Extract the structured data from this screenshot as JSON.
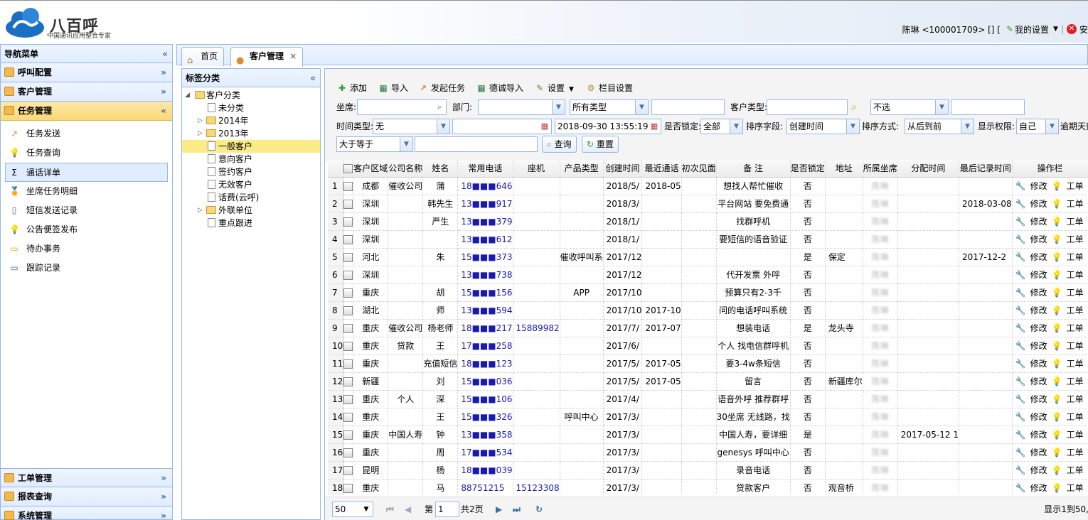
{
  "header": {
    "logo_text": "八百呼",
    "logo_subtitle": "中国通讯应用整合专家",
    "user": "陈琳 <100001709> [] [",
    "my_settings": "我的设置",
    "logout_fragment": "安"
  },
  "nav": {
    "title": "导航菜单",
    "collapse": "«",
    "sections_top": [
      {
        "label": "呼叫配置",
        "chev": "»"
      },
      {
        "label": "客户管理",
        "chev": "»"
      }
    ],
    "active_section": {
      "label": "任务管理",
      "chev": "«"
    },
    "items": [
      {
        "label": "任务发送",
        "icon": "↗"
      },
      {
        "label": "任务查询",
        "icon": "💡"
      },
      {
        "label": "通话详单",
        "icon": "Σ"
      },
      {
        "label": "坐席任务明细",
        "icon": "🏅"
      },
      {
        "label": "短信发送记录",
        "icon": "▯"
      },
      {
        "label": "公告便签发布",
        "icon": "💡"
      },
      {
        "label": "待办事务",
        "icon": "▭"
      },
      {
        "label": "跟踪记录",
        "icon": "▭"
      }
    ],
    "sections_bottom": [
      {
        "label": "工单管理",
        "chev": "»"
      },
      {
        "label": "报表查询",
        "chev": "»"
      },
      {
        "label": "系统管理",
        "chev": "»"
      }
    ]
  },
  "tabs": [
    {
      "label": "首页",
      "icon": "⌂"
    },
    {
      "label": "客户管理",
      "icon": "●",
      "close": "×"
    }
  ],
  "tree": {
    "title": "标签分类",
    "collapse": "«",
    "root": "客户分类",
    "nodes": [
      {
        "label": "未分类",
        "type": "file",
        "level": 1
      },
      {
        "label": "2014年",
        "type": "folder",
        "level": 1,
        "expander": "▷"
      },
      {
        "label": "2013年",
        "type": "folder",
        "level": 1,
        "expander": "▷"
      },
      {
        "label": "一般客户",
        "type": "file",
        "level": 1,
        "selected": true
      },
      {
        "label": "意向客户",
        "type": "file",
        "level": 1
      },
      {
        "label": "签约客户",
        "type": "file",
        "level": 1
      },
      {
        "label": "无效客户",
        "type": "file",
        "level": 1
      },
      {
        "label": "话费(云呼)",
        "type": "file",
        "level": 1
      },
      {
        "label": "外联单位",
        "type": "folder",
        "level": 1,
        "expander": "▷"
      },
      {
        "label": "重点跟进",
        "type": "file",
        "level": 1
      }
    ]
  },
  "toolbar": {
    "add": "添加",
    "import": "导入",
    "start_task": "发起任务",
    "dexin_import": "德诚导入",
    "settings": "设置",
    "column_settings": "栏目设置"
  },
  "filters": {
    "seat_label": "坐席:",
    "dept_label": "部门:",
    "type_select": "所有类型",
    "customer_type_label": "客户类型:",
    "unselected": "不选",
    "time_type_label": "时间类型:",
    "time_type_value": "无",
    "date_value": "2018-09-30 13:55:19",
    "locked_label": "是否锁定:",
    "locked_value": "全部",
    "sort_field_label": "排序字段:",
    "sort_field_value": "创建时间",
    "sort_order_label": "排序方式:",
    "sort_order_value": "从后到前",
    "permission_label": "显示权限:",
    "permission_value": "自己",
    "overdue_label": "逾期天数",
    "compare_value": "大于等于",
    "search_btn": "查询",
    "reset_btn": "重置"
  },
  "table": {
    "headers": [
      "客户区域",
      "公司名称",
      "姓名",
      "常用电话",
      "座机",
      "产品类型",
      "创建时间",
      "最近通话",
      "初次见面",
      "备 注",
      "是否锁定",
      "地址",
      "所属坐席",
      "分配时间",
      "最后记录时间",
      "操作栏"
    ],
    "op_edit": "修改",
    "op_ticket": "工单",
    "rows": [
      {
        "n": "1",
        "region": "成都",
        "company": "催收公司",
        "name": "蒲",
        "phone": "18■■■646",
        "landline": "",
        "product": "",
        "created": "2018/5/",
        "last_call": "2018-05",
        "first": "",
        "note": "想找人帮忙催收",
        "locked": "否",
        "addr": "",
        "seat": "陈琳",
        "assigned": "",
        "last_rec": ""
      },
      {
        "n": "2",
        "region": "深圳",
        "company": "",
        "name": "韩先生",
        "phone": "13■■■917",
        "landline": "",
        "product": "",
        "created": "2018/3/",
        "last_call": "",
        "first": "",
        "note": "平台网站 要免费通",
        "locked": "否",
        "addr": "",
        "seat": "陈琳",
        "assigned": "",
        "last_rec": "2018-03-08"
      },
      {
        "n": "3",
        "region": "深圳",
        "company": "",
        "name": "严生",
        "phone": "13■■■379",
        "landline": "",
        "product": "",
        "created": "2018/1/",
        "last_call": "",
        "first": "",
        "note": "找群呼机",
        "locked": "否",
        "addr": "",
        "seat": "陈琳",
        "assigned": "",
        "last_rec": ""
      },
      {
        "n": "4",
        "region": "深圳",
        "company": "",
        "name": "",
        "phone": "13■■■612",
        "landline": "",
        "product": "",
        "created": "2018/1/",
        "last_call": "",
        "first": "",
        "note": "要短信的语音验证",
        "locked": "否",
        "addr": "",
        "seat": "陈琳",
        "assigned": "",
        "last_rec": ""
      },
      {
        "n": "5",
        "region": "河北",
        "company": "",
        "name": "朱",
        "phone": "15■■■373",
        "landline": "",
        "product": "催收呼叫系",
        "created": "2017/12",
        "last_call": "",
        "first": "",
        "note": "",
        "locked": "是",
        "addr": "保定",
        "seat": "陈琳",
        "assigned": "",
        "last_rec": "2017-12-2"
      },
      {
        "n": "6",
        "region": "深圳",
        "company": "",
        "name": "",
        "phone": "13■■■738",
        "landline": "",
        "product": "",
        "created": "2017/12",
        "last_call": "",
        "first": "",
        "note": "代开发票 外呼",
        "locked": "否",
        "addr": "",
        "seat": "陈琳",
        "assigned": "",
        "last_rec": ""
      },
      {
        "n": "7",
        "region": "重庆",
        "company": "",
        "name": "胡",
        "phone": "15■■■156",
        "landline": "",
        "product": "APP",
        "created": "2017/10",
        "last_call": "",
        "first": "",
        "note": "预算只有2-3千",
        "locked": "否",
        "addr": "",
        "seat": "陈琳",
        "assigned": "",
        "last_rec": ""
      },
      {
        "n": "8",
        "region": "湖北",
        "company": "",
        "name": "师",
        "phone": "13■■■594",
        "landline": "",
        "product": "",
        "created": "2017/10",
        "last_call": "2017-10",
        "first": "",
        "note": "问的电话呼叫系统",
        "locked": "否",
        "addr": "",
        "seat": "陈琳",
        "assigned": "",
        "last_rec": ""
      },
      {
        "n": "9",
        "region": "重庆",
        "company": "催收公司",
        "name": "杨老师",
        "phone": "18■■■217",
        "landline": "15889982",
        "product": "",
        "created": "2017/7/",
        "last_call": "2017-07",
        "first": "",
        "note": "想装电话",
        "locked": "是",
        "addr": "龙头寺",
        "seat": "陈琳",
        "assigned": "",
        "last_rec": ""
      },
      {
        "n": "10",
        "region": "重庆",
        "company": "贷款",
        "name": "王",
        "phone": "17■■■258",
        "landline": "",
        "product": "",
        "created": "2017/6/",
        "last_call": "",
        "first": "",
        "note": "个人 找电信群呼机",
        "locked": "否",
        "addr": "",
        "seat": "陈琳",
        "assigned": "",
        "last_rec": ""
      },
      {
        "n": "11",
        "region": "重庆",
        "company": "",
        "name": "充值短信",
        "phone": "18■■■123",
        "landline": "",
        "product": "",
        "created": "2017/5/",
        "last_call": "2017-05",
        "first": "",
        "note": "要3-4w条短信",
        "locked": "否",
        "addr": "",
        "seat": "陈琳",
        "assigned": "",
        "last_rec": ""
      },
      {
        "n": "12",
        "region": "新疆",
        "company": "",
        "name": "刘",
        "phone": "15■■■036",
        "landline": "",
        "product": "",
        "created": "2017/5/",
        "last_call": "2017-05",
        "first": "",
        "note": "留言",
        "locked": "否",
        "addr": "新疆库尔",
        "seat": "陈琳",
        "assigned": "",
        "last_rec": ""
      },
      {
        "n": "13",
        "region": "重庆",
        "company": "个人",
        "name": "深",
        "phone": "15■■■106",
        "landline": "",
        "product": "",
        "created": "2017/4/",
        "last_call": "",
        "first": "",
        "note": "语音外呼 推荐群呼",
        "locked": "否",
        "addr": "",
        "seat": "陈琳",
        "assigned": "",
        "last_rec": ""
      },
      {
        "n": "14",
        "region": "重庆",
        "company": "",
        "name": "王",
        "phone": "15■■■326",
        "landline": "",
        "product": "呼叫中心",
        "created": "2017/3/",
        "last_call": "",
        "first": "",
        "note": "30坐席 无线路，找",
        "locked": "否",
        "addr": "",
        "seat": "陈琳",
        "assigned": "",
        "last_rec": ""
      },
      {
        "n": "15",
        "region": "重庆",
        "company": "中国人寿",
        "name": "钟",
        "phone": "13■■■358",
        "landline": "",
        "product": "",
        "created": "2017/3/",
        "last_call": "",
        "first": "",
        "note": "中国人寿，要详细",
        "locked": "是",
        "addr": "",
        "seat": "陈琳",
        "assigned": "2017-05-12 1",
        "last_rec": ""
      },
      {
        "n": "16",
        "region": "重庆",
        "company": "",
        "name": "周",
        "phone": "17■■■534",
        "landline": "",
        "product": "",
        "created": "2017/3/",
        "last_call": "",
        "first": "",
        "note": "genesys 呼叫中心",
        "locked": "否",
        "addr": "",
        "seat": "陈琳",
        "assigned": "",
        "last_rec": ""
      },
      {
        "n": "17",
        "region": "昆明",
        "company": "",
        "name": "杨",
        "phone": "18■■■039",
        "landline": "",
        "product": "",
        "created": "2017/3/",
        "last_call": "",
        "first": "",
        "note": "录音电话",
        "locked": "否",
        "addr": "",
        "seat": "陈琳",
        "assigned": "",
        "last_rec": ""
      },
      {
        "n": "18",
        "region": "重庆",
        "company": "",
        "name": "马",
        "phone": "88751215",
        "landline": "15123308",
        "product": "",
        "created": "2017/3/",
        "last_call": "",
        "first": "",
        "note": "贷款客户",
        "locked": "否",
        "addr": "观音桥",
        "seat": "陈琳",
        "assigned": "",
        "last_rec": ""
      }
    ]
  },
  "pager": {
    "page_size": "50",
    "page_prefix": "第",
    "page_value": "1",
    "page_total": "共2页",
    "summary": "显示1到50,"
  }
}
